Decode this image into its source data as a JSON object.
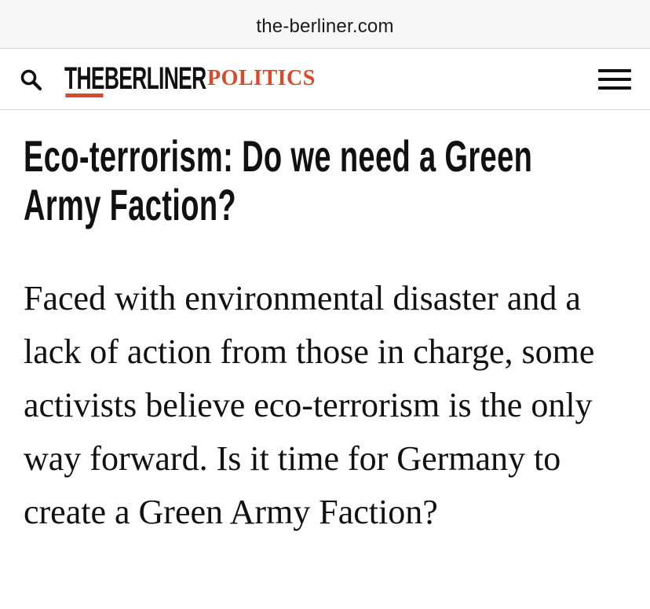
{
  "browser": {
    "url": "the-berliner.com"
  },
  "header": {
    "search_icon": "search-icon",
    "logo_the": "THE",
    "logo_name": "BERLINER",
    "section": "POLITICS",
    "menu_icon": "hamburger-menu-icon",
    "accent_color": "#d84a2b"
  },
  "article": {
    "headline": "Eco-terrorism: Do we need a Green Army Faction?",
    "standfirst": "Faced with environmental disaster and a lack of action from those in charge, some activists believe eco-terrorism is the only way forward. Is it time for Germany to create a Green Army Faction?"
  }
}
